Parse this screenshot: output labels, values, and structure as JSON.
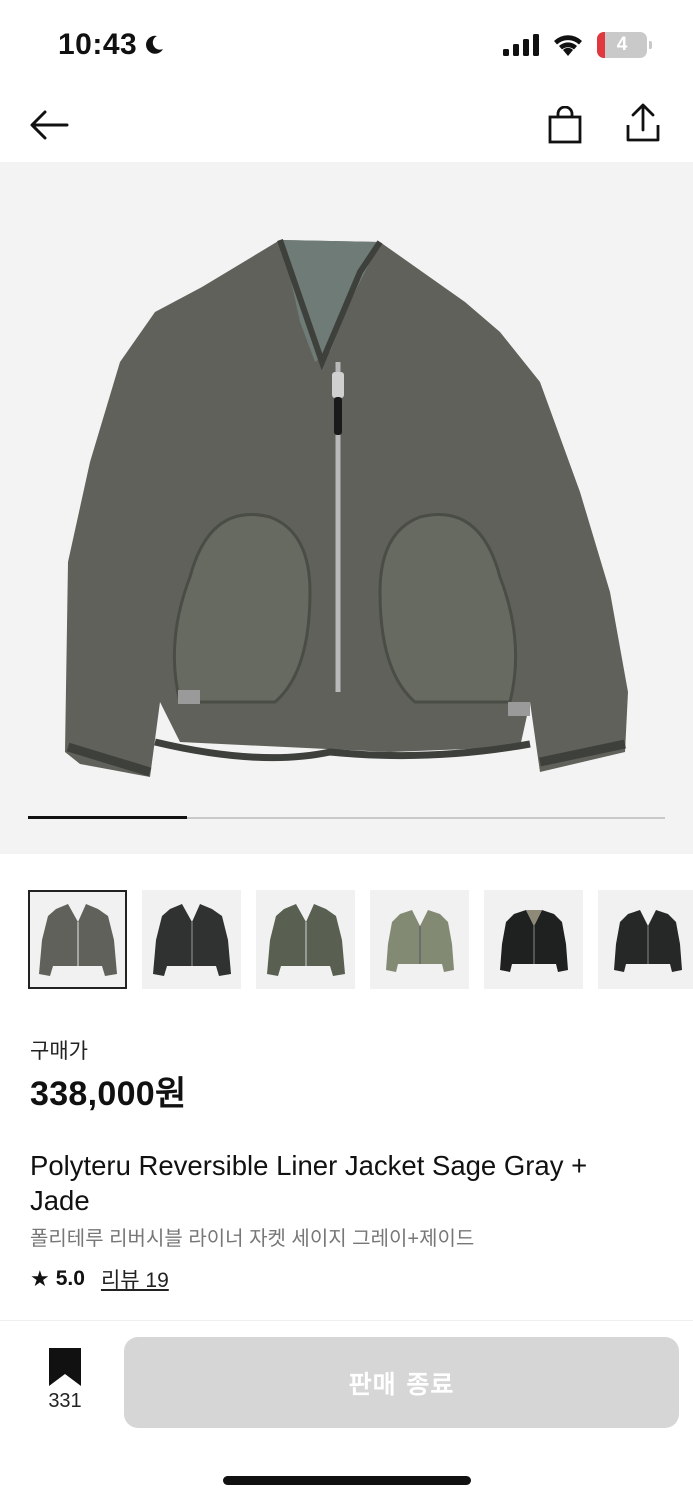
{
  "status_bar": {
    "time": "10:43",
    "battery_level": "4",
    "icons": [
      "moon-icon",
      "cellular-signal-icon",
      "wifi-icon",
      "battery-icon"
    ]
  },
  "nav": {
    "icons": [
      "back-arrow-icon",
      "shopping-bag-icon",
      "share-icon"
    ]
  },
  "gallery": {
    "progress": 0.25,
    "thumbnail_count": 6,
    "selected_index": 0
  },
  "product": {
    "price_label": "구매가",
    "price": "338,000원",
    "title_en": "Polyteru Reversible Liner Jacket Sage Gray + Jade",
    "title_ko": "폴리테루 리버시블 라이너 자켓 세이지 그레이+제이드",
    "rating": "5.0",
    "review_link": "리뷰 19"
  },
  "bottom_bar": {
    "bookmark_count": "331",
    "sold_out_label": "판매 종료"
  },
  "colors": {
    "jacket_sage": "#5f615a",
    "jacket_dark": "#2f3230",
    "jacket_olive": "#596052",
    "jacket_khaki": "#838a74",
    "jacket_black": "#1f2020",
    "button_disabled": "#d6d6d6"
  }
}
